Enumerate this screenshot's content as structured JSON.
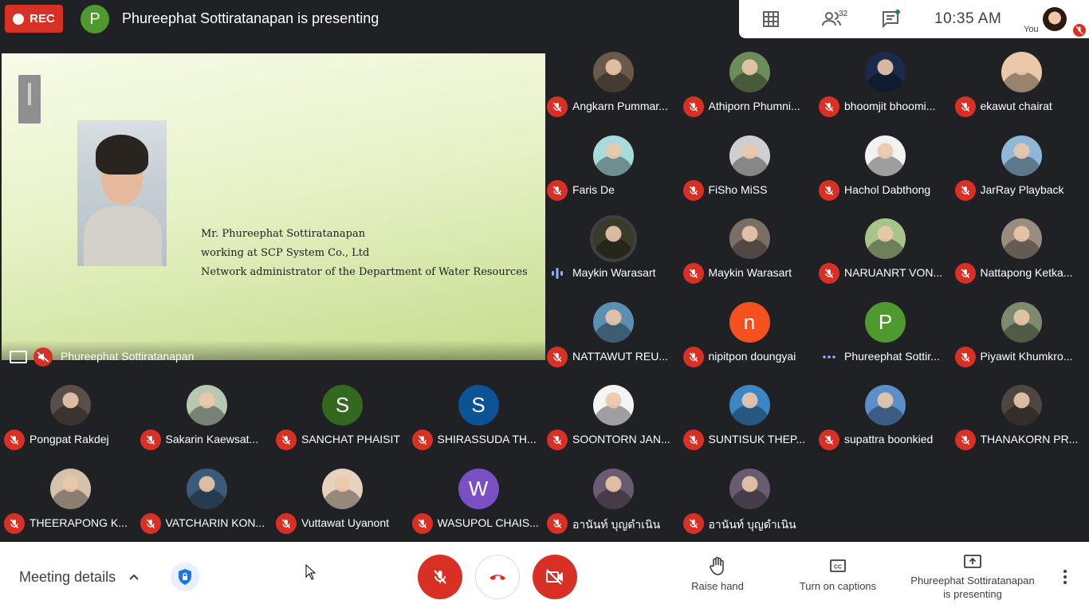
{
  "recording": {
    "label": "REC"
  },
  "presenter": {
    "initial": "P",
    "banner": "Phureephat Sottiratanapan is presenting",
    "tile_name": "Phureephat Sottiratanapan"
  },
  "topbar": {
    "participants_count": "32",
    "time": "10:35  AM",
    "you_label": "You"
  },
  "slide": {
    "lines": [
      "Mr. Phureephat Sottiratanapan",
      "working at SCP System Co., Ltd",
      "Network administrator of the Department of Water Resources"
    ]
  },
  "participants": [
    {
      "name": "Angkarn Pummar...",
      "avatar": "photo",
      "color": "#6b5a4a",
      "mic": "muted"
    },
    {
      "name": "Athiporn Phumni...",
      "avatar": "photo",
      "color": "#6d8c5a",
      "mic": "muted"
    },
    {
      "name": "bhoomjit bhoomi...",
      "avatar": "photo",
      "color": "#1a2a4a",
      "mic": "muted"
    },
    {
      "name": "ekawut chairat",
      "avatar": "photo",
      "color": "#e9c9a8",
      "mic": "muted"
    },
    {
      "name": "Faris De",
      "avatar": "photo",
      "color": "#a8dcdc",
      "mic": "muted"
    },
    {
      "name": "FiSho MiSS",
      "avatar": "photo",
      "color": "#cfcfcf",
      "mic": "muted"
    },
    {
      "name": "Hachol Dabthong",
      "avatar": "photo",
      "color": "#f2f2f2",
      "mic": "muted"
    },
    {
      "name": "JarRay Playback",
      "avatar": "photo",
      "color": "#8fb7d6",
      "mic": "muted"
    },
    {
      "name": "Maykin Warasart",
      "avatar": "photo",
      "color": "#3a3a2a",
      "mic": "speaking"
    },
    {
      "name": "Maykin Warasart",
      "avatar": "photo",
      "color": "#7a6e66",
      "mic": "muted"
    },
    {
      "name": "NARUANRT VON...",
      "avatar": "photo",
      "color": "#a7c48a",
      "mic": "muted"
    },
    {
      "name": "Nattapong Ketka...",
      "avatar": "photo",
      "color": "#9a8c80",
      "mic": "muted"
    },
    {
      "name": "NATTAWUT REU...",
      "avatar": "photo",
      "color": "#5d8fb0",
      "mic": "muted"
    },
    {
      "name": "nipitpon doungyai",
      "avatar": "letter",
      "letter": "n",
      "color": "#f4511e",
      "mic": "muted"
    },
    {
      "name": "Phureephat Sottir...",
      "avatar": "letter",
      "letter": "P",
      "color": "#4e9a2e",
      "mic": "dots"
    },
    {
      "name": "Piyawit Khumkro...",
      "avatar": "photo",
      "color": "#7d8a6e",
      "mic": "muted"
    },
    {
      "name": "Pongpat Rakdej",
      "avatar": "photo",
      "color": "#5a4e48",
      "mic": "muted"
    },
    {
      "name": "Sakarin Kaewsat...",
      "avatar": "photo",
      "color": "#b9c6b0",
      "mic": "muted"
    },
    {
      "name": "SANCHAT PHAISIT",
      "avatar": "letter",
      "letter": "S",
      "color": "#33691e",
      "mic": "muted"
    },
    {
      "name": "SHIRASSUDA TH...",
      "avatar": "letter",
      "letter": "S",
      "color": "#0b5394",
      "mic": "muted"
    },
    {
      "name": "SOONTORN JAN...",
      "avatar": "photo",
      "color": "#f4f4f4",
      "mic": "muted"
    },
    {
      "name": "SUNTISUK THEP...",
      "avatar": "photo",
      "color": "#3d86c6",
      "mic": "muted"
    },
    {
      "name": "supattra boonkied",
      "avatar": "photo",
      "color": "#5b8fc9",
      "mic": "muted"
    },
    {
      "name": "THANAKORN PR...",
      "avatar": "photo",
      "color": "#4e4640",
      "mic": "muted"
    },
    {
      "name": "THEERAPONG K...",
      "avatar": "photo",
      "color": "#d6c1ad",
      "mic": "muted"
    },
    {
      "name": "VATCHARIN KON...",
      "avatar": "photo",
      "color": "#3c5a7a",
      "mic": "muted"
    },
    {
      "name": "Vuttawat Uyanont",
      "avatar": "photo",
      "color": "#e6d2bf",
      "mic": "muted"
    },
    {
      "name": "WASUPOL CHAIS...",
      "avatar": "letter",
      "letter": "W",
      "color": "#7b4fc4",
      "mic": "muted"
    },
    {
      "name": "อานันท์ บุญดำเนิน",
      "avatar": "photo",
      "color": "#6a5c70",
      "mic": "muted"
    },
    {
      "name": "อานันท์ บุญดำเนิน",
      "avatar": "photo",
      "color": "#6a5c70",
      "mic": "muted"
    }
  ],
  "bottombar": {
    "meeting_details": "Meeting details",
    "raise_hand": "Raise hand",
    "captions": "Turn on captions",
    "presenting_line1": "Phureephat Sottiratanapan",
    "presenting_line2": "is presenting"
  },
  "colors": {
    "accent_red": "#d93025",
    "background": "#202124",
    "presenter_green": "#4e9a2e"
  },
  "icons": [
    "grid-icon",
    "people-icon",
    "chat-icon",
    "mic-off-icon",
    "hangup-icon",
    "camera-off-icon",
    "hand-icon",
    "captions-icon",
    "present-icon",
    "more-vert-icon",
    "shield-icon",
    "chevron-up-icon"
  ]
}
